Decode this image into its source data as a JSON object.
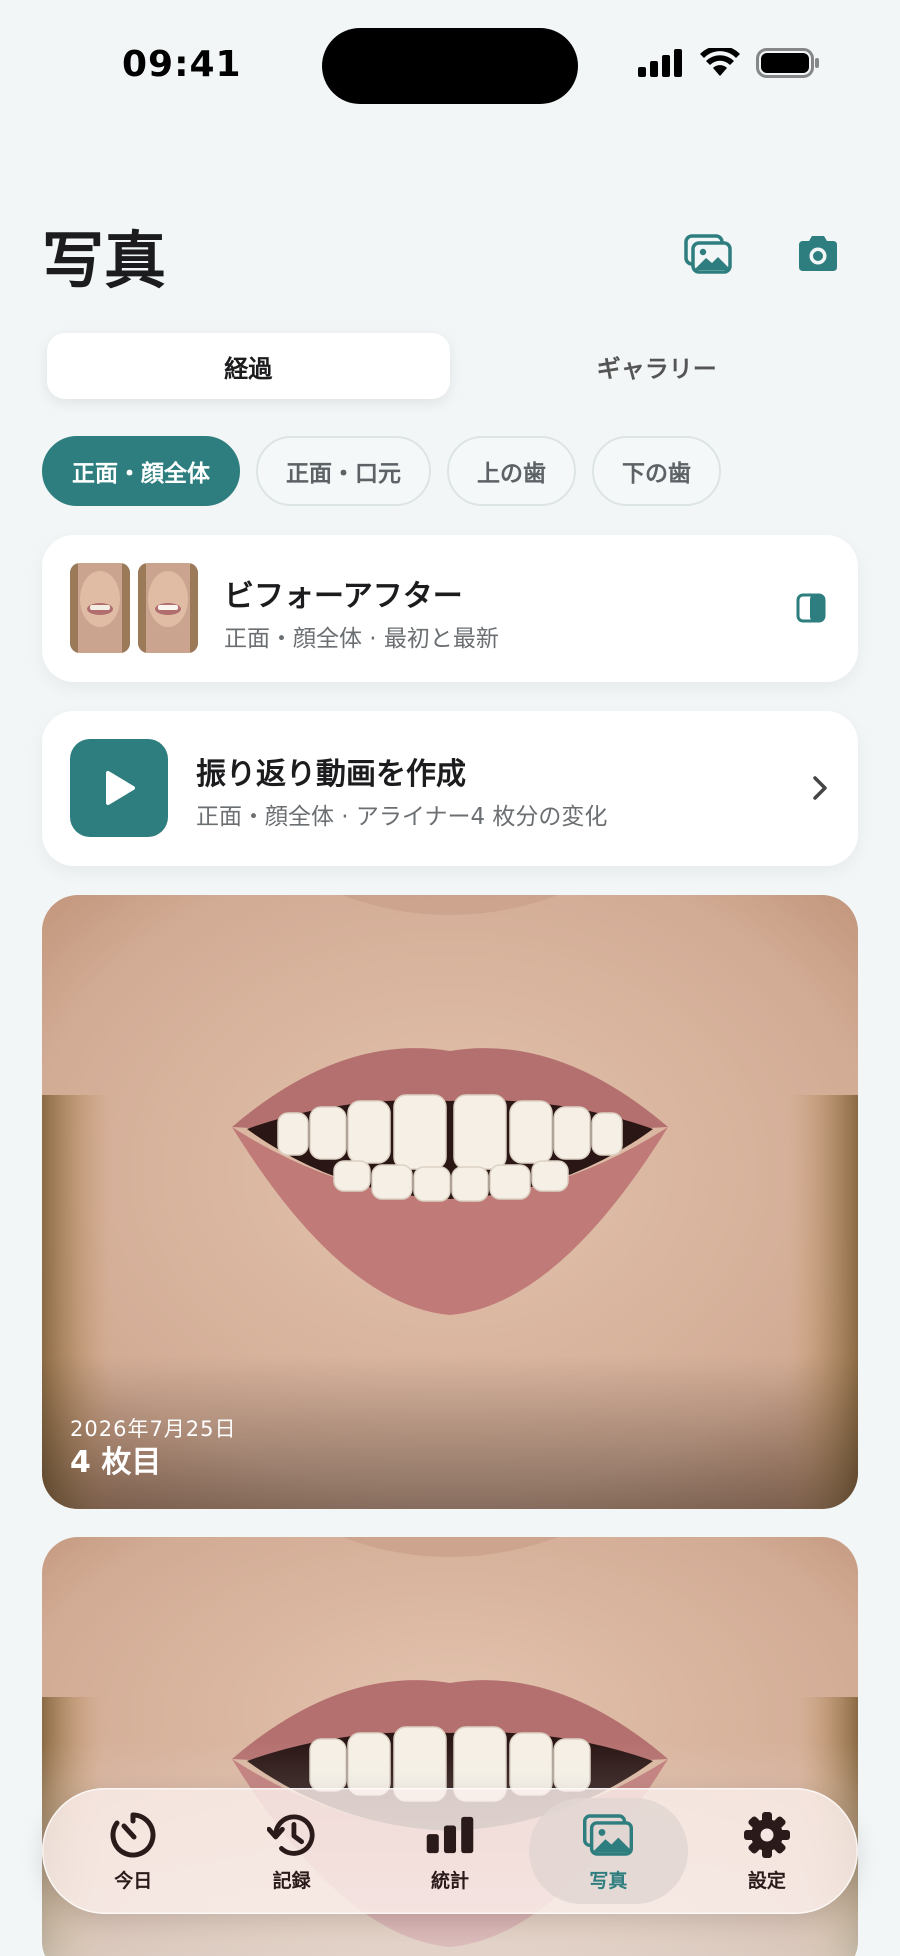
{
  "status_bar": {
    "time": "09:41"
  },
  "header": {
    "title": "写真",
    "gallery_icon": "photo-stack-icon",
    "camera_icon": "camera-icon"
  },
  "tabs": [
    {
      "label": "経過",
      "active": true
    },
    {
      "label": "ギャラリー",
      "active": false
    }
  ],
  "filters": [
    {
      "label": "正面・顔全体",
      "active": true
    },
    {
      "label": "正面・口元",
      "active": false
    },
    {
      "label": "上の歯",
      "active": false
    },
    {
      "label": "下の歯",
      "active": false
    }
  ],
  "before_after": {
    "title": "ビフォーアフター",
    "subtitle": "正面・顔全体 · 最初と最新",
    "icon": "split-view-icon"
  },
  "video": {
    "title": "振り返り動画を作成",
    "subtitle": "正面・顔全体 · アライナー4 枚分の変化",
    "icon": "play-icon"
  },
  "photos": [
    {
      "date": "2026年7月25日",
      "label": "4 枚目"
    }
  ],
  "tab_bar": [
    {
      "label": "今日",
      "icon": "timer-icon",
      "active": false
    },
    {
      "label": "記録",
      "icon": "history-icon",
      "active": false
    },
    {
      "label": "統計",
      "icon": "bar-chart-icon",
      "active": false
    },
    {
      "label": "写真",
      "icon": "photos-icon",
      "active": true
    },
    {
      "label": "設定",
      "icon": "gear-icon",
      "active": false
    }
  ],
  "colors": {
    "accent": "#2e7e7f",
    "background": "#f2f6f7"
  }
}
